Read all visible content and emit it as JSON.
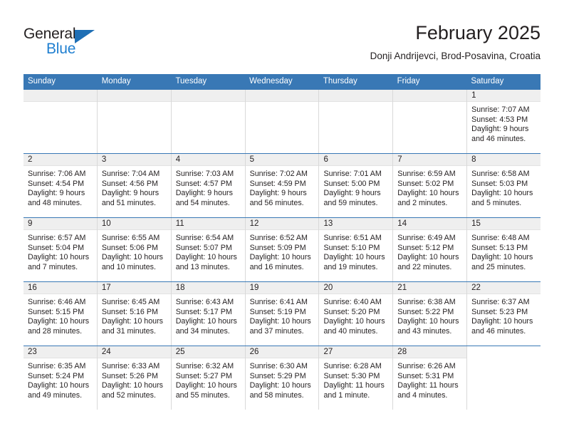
{
  "brand": {
    "name_part1": "General",
    "name_part2": "Blue",
    "logo_icon": "triangle-logo-icon",
    "color_dark": "#231f20",
    "color_blue": "#1f7fd0"
  },
  "header": {
    "title": "February 2025",
    "location": "Donji Andrijevci, Brod-Posavina, Croatia"
  },
  "theme": {
    "header_row_bg": "#3978b5",
    "day_strip_bg": "#efefef",
    "grid_line": "#d9d9d9"
  },
  "weekdays": [
    "Sunday",
    "Monday",
    "Tuesday",
    "Wednesday",
    "Thursday",
    "Friday",
    "Saturday"
  ],
  "weeks": [
    [
      {
        "day": "",
        "sunrise": "",
        "sunset": "",
        "daylight": "",
        "blank": true
      },
      {
        "day": "",
        "sunrise": "",
        "sunset": "",
        "daylight": "",
        "blank": true
      },
      {
        "day": "",
        "sunrise": "",
        "sunset": "",
        "daylight": "",
        "blank": true
      },
      {
        "day": "",
        "sunrise": "",
        "sunset": "",
        "daylight": "",
        "blank": true
      },
      {
        "day": "",
        "sunrise": "",
        "sunset": "",
        "daylight": "",
        "blank": true
      },
      {
        "day": "",
        "sunrise": "",
        "sunset": "",
        "daylight": "",
        "blank": true
      },
      {
        "day": "1",
        "sunrise": "Sunrise: 7:07 AM",
        "sunset": "Sunset: 4:53 PM",
        "daylight": "Daylight: 9 hours and 46 minutes."
      }
    ],
    [
      {
        "day": "2",
        "sunrise": "Sunrise: 7:06 AM",
        "sunset": "Sunset: 4:54 PM",
        "daylight": "Daylight: 9 hours and 48 minutes."
      },
      {
        "day": "3",
        "sunrise": "Sunrise: 7:04 AM",
        "sunset": "Sunset: 4:56 PM",
        "daylight": "Daylight: 9 hours and 51 minutes."
      },
      {
        "day": "4",
        "sunrise": "Sunrise: 7:03 AM",
        "sunset": "Sunset: 4:57 PM",
        "daylight": "Daylight: 9 hours and 54 minutes."
      },
      {
        "day": "5",
        "sunrise": "Sunrise: 7:02 AM",
        "sunset": "Sunset: 4:59 PM",
        "daylight": "Daylight: 9 hours and 56 minutes."
      },
      {
        "day": "6",
        "sunrise": "Sunrise: 7:01 AM",
        "sunset": "Sunset: 5:00 PM",
        "daylight": "Daylight: 9 hours and 59 minutes."
      },
      {
        "day": "7",
        "sunrise": "Sunrise: 6:59 AM",
        "sunset": "Sunset: 5:02 PM",
        "daylight": "Daylight: 10 hours and 2 minutes."
      },
      {
        "day": "8",
        "sunrise": "Sunrise: 6:58 AM",
        "sunset": "Sunset: 5:03 PM",
        "daylight": "Daylight: 10 hours and 5 minutes."
      }
    ],
    [
      {
        "day": "9",
        "sunrise": "Sunrise: 6:57 AM",
        "sunset": "Sunset: 5:04 PM",
        "daylight": "Daylight: 10 hours and 7 minutes."
      },
      {
        "day": "10",
        "sunrise": "Sunrise: 6:55 AM",
        "sunset": "Sunset: 5:06 PM",
        "daylight": "Daylight: 10 hours and 10 minutes."
      },
      {
        "day": "11",
        "sunrise": "Sunrise: 6:54 AM",
        "sunset": "Sunset: 5:07 PM",
        "daylight": "Daylight: 10 hours and 13 minutes."
      },
      {
        "day": "12",
        "sunrise": "Sunrise: 6:52 AM",
        "sunset": "Sunset: 5:09 PM",
        "daylight": "Daylight: 10 hours and 16 minutes."
      },
      {
        "day": "13",
        "sunrise": "Sunrise: 6:51 AM",
        "sunset": "Sunset: 5:10 PM",
        "daylight": "Daylight: 10 hours and 19 minutes."
      },
      {
        "day": "14",
        "sunrise": "Sunrise: 6:49 AM",
        "sunset": "Sunset: 5:12 PM",
        "daylight": "Daylight: 10 hours and 22 minutes."
      },
      {
        "day": "15",
        "sunrise": "Sunrise: 6:48 AM",
        "sunset": "Sunset: 5:13 PM",
        "daylight": "Daylight: 10 hours and 25 minutes."
      }
    ],
    [
      {
        "day": "16",
        "sunrise": "Sunrise: 6:46 AM",
        "sunset": "Sunset: 5:15 PM",
        "daylight": "Daylight: 10 hours and 28 minutes."
      },
      {
        "day": "17",
        "sunrise": "Sunrise: 6:45 AM",
        "sunset": "Sunset: 5:16 PM",
        "daylight": "Daylight: 10 hours and 31 minutes."
      },
      {
        "day": "18",
        "sunrise": "Sunrise: 6:43 AM",
        "sunset": "Sunset: 5:17 PM",
        "daylight": "Daylight: 10 hours and 34 minutes."
      },
      {
        "day": "19",
        "sunrise": "Sunrise: 6:41 AM",
        "sunset": "Sunset: 5:19 PM",
        "daylight": "Daylight: 10 hours and 37 minutes."
      },
      {
        "day": "20",
        "sunrise": "Sunrise: 6:40 AM",
        "sunset": "Sunset: 5:20 PM",
        "daylight": "Daylight: 10 hours and 40 minutes."
      },
      {
        "day": "21",
        "sunrise": "Sunrise: 6:38 AM",
        "sunset": "Sunset: 5:22 PM",
        "daylight": "Daylight: 10 hours and 43 minutes."
      },
      {
        "day": "22",
        "sunrise": "Sunrise: 6:37 AM",
        "sunset": "Sunset: 5:23 PM",
        "daylight": "Daylight: 10 hours and 46 minutes."
      }
    ],
    [
      {
        "day": "23",
        "sunrise": "Sunrise: 6:35 AM",
        "sunset": "Sunset: 5:24 PM",
        "daylight": "Daylight: 10 hours and 49 minutes."
      },
      {
        "day": "24",
        "sunrise": "Sunrise: 6:33 AM",
        "sunset": "Sunset: 5:26 PM",
        "daylight": "Daylight: 10 hours and 52 minutes."
      },
      {
        "day": "25",
        "sunrise": "Sunrise: 6:32 AM",
        "sunset": "Sunset: 5:27 PM",
        "daylight": "Daylight: 10 hours and 55 minutes."
      },
      {
        "day": "26",
        "sunrise": "Sunrise: 6:30 AM",
        "sunset": "Sunset: 5:29 PM",
        "daylight": "Daylight: 10 hours and 58 minutes."
      },
      {
        "day": "27",
        "sunrise": "Sunrise: 6:28 AM",
        "sunset": "Sunset: 5:30 PM",
        "daylight": "Daylight: 11 hours and 1 minute."
      },
      {
        "day": "28",
        "sunrise": "Sunrise: 6:26 AM",
        "sunset": "Sunset: 5:31 PM",
        "daylight": "Daylight: 11 hours and 4 minutes."
      },
      {
        "day": "",
        "sunrise": "",
        "sunset": "",
        "daylight": "",
        "empty_tail": true
      }
    ]
  ]
}
